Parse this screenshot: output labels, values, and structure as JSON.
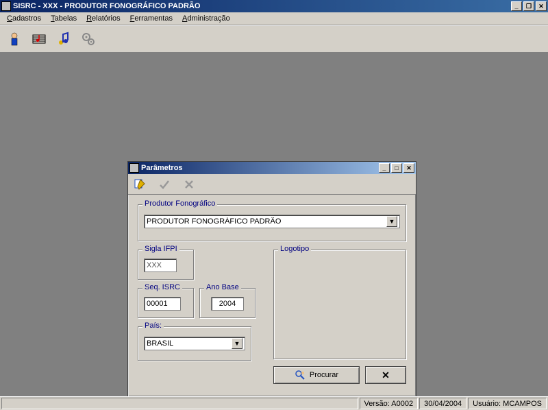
{
  "window": {
    "title": "SISRC - XXX - PRODUTOR FONOGRÁFICO PADRÃO"
  },
  "menu": {
    "cadastros": "Cadastros",
    "tabelas": "Tabelas",
    "relatorios": "Relatórios",
    "ferramentas": "Ferramentas",
    "administracao": "Administração"
  },
  "toolbar_icons": {
    "person": "person-icon",
    "music_sheet": "music-sheet-icon",
    "notes": "music-notes-icon",
    "gears": "gears-icon"
  },
  "status": {
    "version_label": "Versão: A0002",
    "date": "30/04/2004",
    "user_label": "Usuário: MCAMPOS"
  },
  "dialog": {
    "title": "Parâmetros",
    "group_produtor": "Produtor Fonográfico",
    "produtor_value": "PRODUTOR FONOGRÁFICO PADRÃO",
    "group_sigla": "Sigla IFPI",
    "sigla_value": "XXX",
    "group_seq": "Seq. ISRC",
    "seq_value": "00001",
    "group_ano": "Ano Base",
    "ano_value": "2004",
    "group_pais": "País:",
    "pais_value": "BRASIL",
    "group_logo": "Logotipo",
    "btn_procurar": "Procurar",
    "btn_close": "✕"
  }
}
